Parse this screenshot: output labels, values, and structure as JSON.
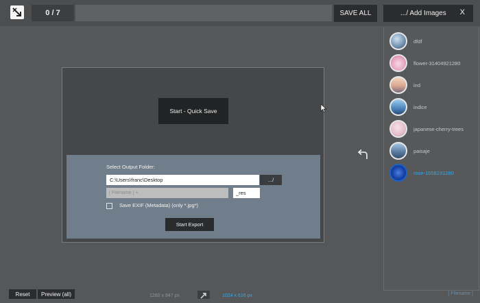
{
  "header": {
    "logo_icon": "resize-arrow-icon",
    "counter": "0 / 7",
    "save_all": "SAVE ALL",
    "add_images": ".../ Add Images",
    "close": "X"
  },
  "image_list": {
    "items": [
      {
        "name": "dfdf",
        "thumb": "#6f8fae",
        "selected": false
      },
      {
        "name": "flower-31404921280",
        "thumb": "#e7a9c4",
        "selected": false
      },
      {
        "name": "ind",
        "thumb": "#d9a88e",
        "selected": false
      },
      {
        "name": "indice",
        "thumb": "#4d84b8",
        "selected": false
      },
      {
        "name": "japanese-cherry-trees",
        "thumb": "#e4bccb",
        "selected": false
      },
      {
        "name": "paisaje",
        "thumb": "#5d7ea3",
        "selected": false
      },
      {
        "name": "rose-1658191280",
        "thumb": "#1843a8",
        "selected": true
      }
    ],
    "footer": "[ Filename ]"
  },
  "dialog": {
    "quick_save": "Start - Quick Save",
    "select_output_label": "Select Output Folder:",
    "output_path": "C:\\Users\\franc\\Desktop",
    "browse": ".../",
    "filename_placeholder": "[ Filename ] +",
    "suffix": "_res",
    "exif_label": "Save EXIF (Metadata) (only *.jpg*)",
    "exif_checked": false,
    "start_export": "Start Export"
  },
  "footer": {
    "reset": "Reset",
    "preview": "Preview (all)",
    "original_size": "1280 x 847 px",
    "new_size": "1024 x 616 px"
  },
  "colors": {
    "accent": "#38a8e6",
    "background": "#555759",
    "dark_button": "#2b2c2e",
    "export_panel": "#707d8a"
  }
}
